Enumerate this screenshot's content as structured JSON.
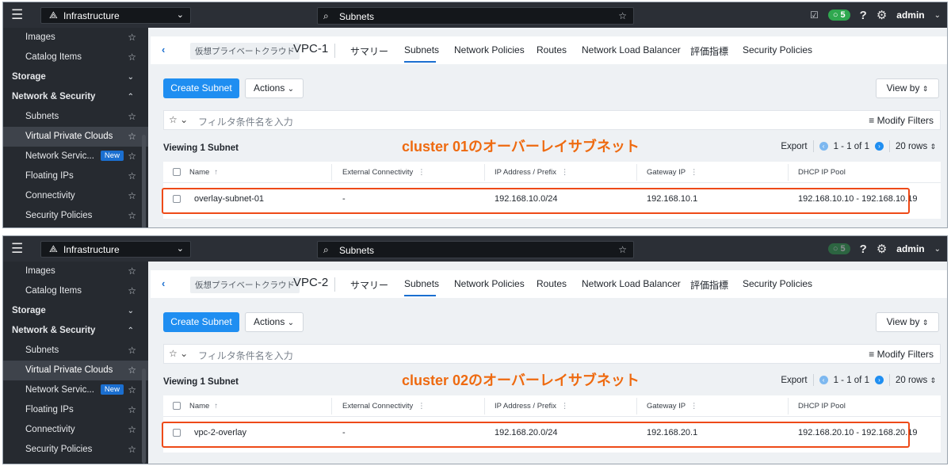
{
  "panels": [
    {
      "topbar": {
        "app_name": "Infrastructure",
        "search_value": "Subnets",
        "task_count": "5",
        "user": "admin"
      },
      "sidebar": [
        {
          "label": "Images",
          "type": "item"
        },
        {
          "label": "Catalog Items",
          "type": "item"
        },
        {
          "label": "Storage",
          "type": "section",
          "caret": "⌄"
        },
        {
          "label": "Network & Security",
          "type": "section",
          "caret": "⌃"
        },
        {
          "label": "Subnets",
          "type": "item"
        },
        {
          "label": "Virtual Private Clouds",
          "type": "item",
          "active": true
        },
        {
          "label": "Network Servic...",
          "type": "item",
          "badge": "New"
        },
        {
          "label": "Floating IPs",
          "type": "item"
        },
        {
          "label": "Connectivity",
          "type": "item"
        },
        {
          "label": "Security Policies",
          "type": "item"
        }
      ],
      "vpc": {
        "type_label": "仮想プライベートクラウド",
        "name": "VPC-1"
      },
      "tabs": [
        "サマリー",
        "Subnets",
        "Network Policies",
        "Routes",
        "Network Load Balancer",
        "評価指標",
        "Security Policies"
      ],
      "active_tab": 1,
      "toolbar": {
        "create": "Create Subnet",
        "actions": "Actions",
        "view_by": "View by"
      },
      "filter": {
        "placeholder": "フィルタ条件名を入力",
        "modify": "Modify Filters"
      },
      "list": {
        "title": "Viewing 1 Subnet",
        "export": "Export",
        "range": "1 - 1 of 1",
        "rows": "20 rows"
      },
      "annotation": "cluster 01のオーバーレイサブネット",
      "columns": [
        "Name",
        "External Connectivity",
        "IP Address / Prefix",
        "Gateway IP",
        "DHCP IP Pool"
      ],
      "row": [
        "overlay-subnet-01",
        "-",
        "192.168.10.0/24",
        "192.168.10.1",
        "192.168.10.10 - 192.168.10.19"
      ]
    },
    {
      "topbar": {
        "app_name": "Infrastructure",
        "search_value": "Subnets",
        "task_count": "5",
        "user": "admin"
      },
      "sidebar": [
        {
          "label": "Images",
          "type": "item"
        },
        {
          "label": "Catalog Items",
          "type": "item"
        },
        {
          "label": "Storage",
          "type": "section",
          "caret": "⌄"
        },
        {
          "label": "Network & Security",
          "type": "section",
          "caret": "⌃"
        },
        {
          "label": "Subnets",
          "type": "item"
        },
        {
          "label": "Virtual Private Clouds",
          "type": "item",
          "active": true
        },
        {
          "label": "Network Servic...",
          "type": "item",
          "badge": "New"
        },
        {
          "label": "Floating IPs",
          "type": "item"
        },
        {
          "label": "Connectivity",
          "type": "item"
        },
        {
          "label": "Security Policies",
          "type": "item"
        }
      ],
      "vpc": {
        "type_label": "仮想プライベートクラウド",
        "name": "VPC-2"
      },
      "tabs": [
        "サマリー",
        "Subnets",
        "Network Policies",
        "Routes",
        "Network Load Balancer",
        "評価指標",
        "Security Policies"
      ],
      "active_tab": 1,
      "toolbar": {
        "create": "Create Subnet",
        "actions": "Actions",
        "view_by": "View by"
      },
      "filter": {
        "placeholder": "フィルタ条件名を入力",
        "modify": "Modify Filters"
      },
      "list": {
        "title": "Viewing 1 Subnet",
        "export": "Export",
        "range": "1 - 1 of 1",
        "rows": "20 rows"
      },
      "annotation": "cluster 02のオーバーレイサブネット",
      "columns": [
        "Name",
        "External Connectivity",
        "IP Address / Prefix",
        "Gateway IP",
        "DHCP IP Pool"
      ],
      "row": [
        "vpc-2-overlay",
        "-",
        "192.168.20.0/24",
        "192.168.20.1",
        "192.168.20.10 - 192.168.20.19"
      ]
    }
  ],
  "icons": {
    "menu": "hamburger-icon",
    "star": "star-icon",
    "search": "search-icon",
    "help": "help-icon",
    "settings": "gear-icon"
  },
  "colors": {
    "topbar": "#2b2f36",
    "sidebar": "#262a30",
    "accent": "#1f8ef1",
    "annotation": "#ee6a10",
    "highlight": "#ee4a18",
    "task_badge": "#2fa84f"
  }
}
